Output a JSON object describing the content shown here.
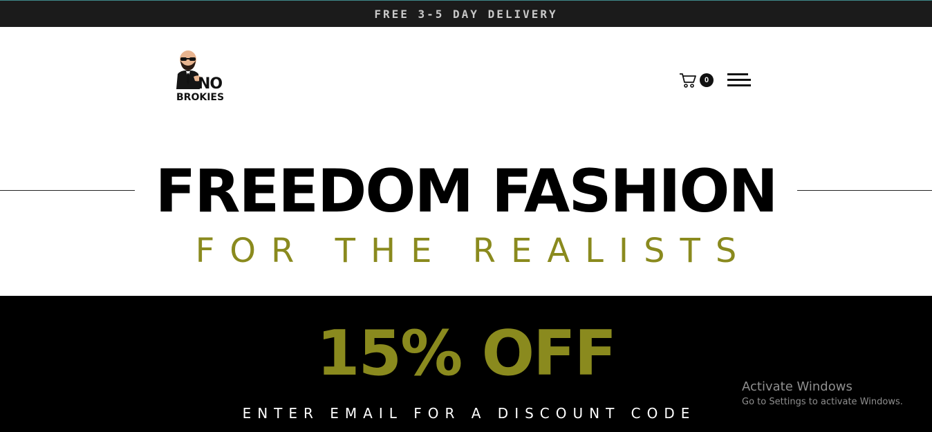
{
  "announcement": {
    "text": "FREE 3-5 DAY DELIVERY"
  },
  "header": {
    "logo": {
      "top_text": "NO",
      "bottom_text": "BROKIES"
    },
    "cart": {
      "count": "0"
    }
  },
  "hero": {
    "title": "FREEDOM FASHION",
    "subtitle": "FOR THE REALISTS"
  },
  "promo": {
    "title": "15% OFF",
    "subtitle": "ENTER EMAIL FOR A DISCOUNT CODE"
  },
  "watermark": {
    "title": "Activate Windows",
    "subtitle": "Go to Settings to activate Windows."
  },
  "colors": {
    "accent_olive": "#8a8a1e",
    "topbar_bg": "#1b1b1b",
    "promo_bg": "#000000"
  },
  "icons": [
    "cart-icon",
    "hamburger-menu-icon",
    "logo-mascot-icon"
  ]
}
